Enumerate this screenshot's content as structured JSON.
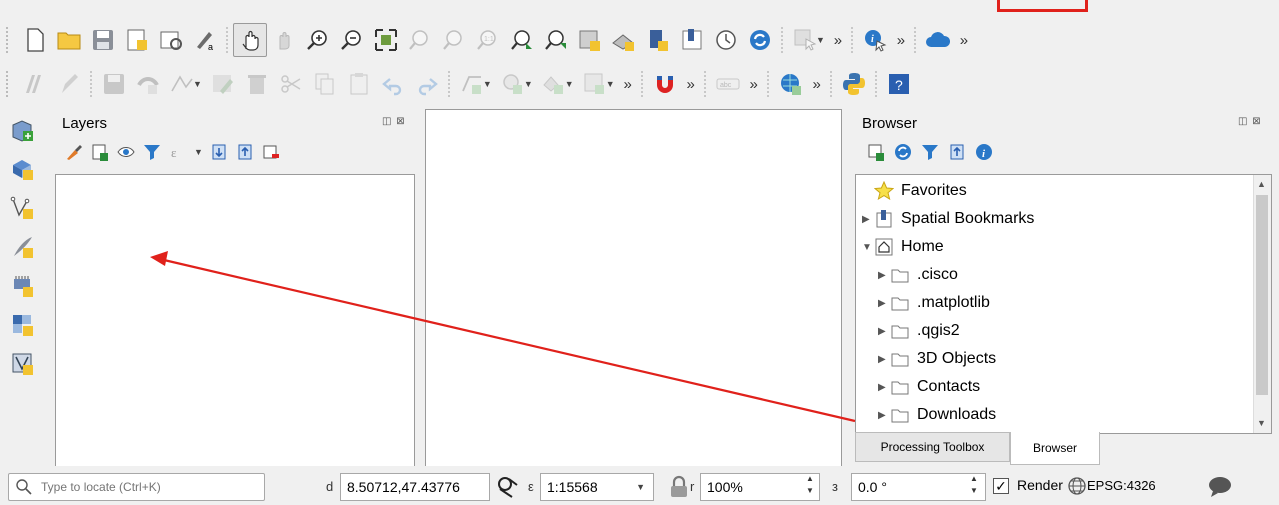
{
  "colors": {
    "annotation_red": "#e0211b",
    "accent_blue": "#2a78c8",
    "folder_yellow": "#f5c842"
  },
  "toolbar1": {
    "icons": [
      "new-project-icon",
      "open-project-icon",
      "save-project-icon",
      "print-layout-icon",
      "layout-manager-icon",
      "style-manager-icon",
      "pan-icon",
      "pan-to-selection-icon",
      "zoom-in-icon",
      "zoom-out-icon",
      "zoom-full-icon",
      "zoom-to-selection-icon",
      "zoom-to-layer-icon",
      "zoom-native-icon",
      "zoom-last-icon",
      "zoom-next-icon",
      "new-map-view-icon",
      "new-3d-view-icon",
      "new-bookmark-icon",
      "show-bookmarks-icon",
      "temporal-controller-icon",
      "refresh-icon",
      "select-features-icon",
      "identify-icon",
      "cloud-icon"
    ],
    "overflow": "»"
  },
  "toolbar2": {
    "icons": [
      "current-edits-icon",
      "toggle-editing-icon",
      "save-edits-icon",
      "digitize-icon",
      "vertex-tool-icon",
      "modify-attributes-icon",
      "delete-selected-icon",
      "cut-features-icon",
      "copy-features-icon",
      "paste-features-icon",
      "undo-icon",
      "redo-icon",
      "digitize-shape-icon",
      "select-by-area-icon",
      "select-by-value-icon",
      "deselect-icon",
      "magnet-icon",
      "label-icon",
      "globe-icon",
      "python-icon",
      "help-icon"
    ],
    "overflow": "»"
  },
  "left_strip": {
    "icons": [
      "data-source-manager-icon",
      "new-geopackage-layer-icon",
      "add-vector-layer-icon",
      "new-shapefile-layer-icon",
      "new-spatialite-layer-icon",
      "add-raster-layer-icon",
      "new-virtual-layer-icon"
    ]
  },
  "layers_panel": {
    "title": "Layers",
    "float_close": "◫ ⊠",
    "tools": [
      "open-layer-styling-icon",
      "add-group-icon",
      "manage-visibility-icon",
      "filter-legend-icon",
      "filter-by-expression-icon",
      "expand-all-icon",
      "collapse-all-icon",
      "remove-layer-icon"
    ]
  },
  "browser_panel": {
    "title": "Browser",
    "float_close": "◫ ⊠",
    "tools": [
      "add-selected-icon",
      "refresh-icon",
      "filter-icon",
      "collapse-all-icon",
      "properties-icon"
    ],
    "items": [
      {
        "label": "Favorites",
        "icon": "star-icon",
        "expandable": false,
        "indent": 0
      },
      {
        "label": "Spatial Bookmarks",
        "icon": "bookmark-icon",
        "expandable": true,
        "indent": 0
      },
      {
        "label": "Home",
        "icon": "home-icon",
        "expandable": true,
        "expanded": true,
        "indent": 0
      },
      {
        "label": ".cisco",
        "icon": "folder-icon",
        "expandable": true,
        "indent": 1
      },
      {
        "label": ".matplotlib",
        "icon": "folder-icon",
        "expandable": true,
        "indent": 1
      },
      {
        "label": ".qgis2",
        "icon": "folder-icon",
        "expandable": true,
        "indent": 1
      },
      {
        "label": "3D Objects",
        "icon": "folder-icon",
        "expandable": true,
        "indent": 1
      },
      {
        "label": "Contacts",
        "icon": "folder-icon",
        "expandable": true,
        "indent": 1
      },
      {
        "label": "Downloads",
        "icon": "folder-icon",
        "expandable": true,
        "indent": 1
      }
    ]
  },
  "bottom_tabs": {
    "processing": "Processing Toolbox",
    "browser": "Browser",
    "active": "Browser"
  },
  "statusbar": {
    "locator_placeholder": "Type to locate (Ctrl+K)",
    "coordinate_label": "d",
    "coordinate": "8.50712,47.43776",
    "scale_label": "ε",
    "scale": "1:15568",
    "magnifier_label": "r",
    "magnifier": "100%",
    "rotation_label": "з",
    "rotation": "0.0 °",
    "render_label": "Render",
    "render_checked": "✓",
    "crs": "EPSG:4326"
  }
}
